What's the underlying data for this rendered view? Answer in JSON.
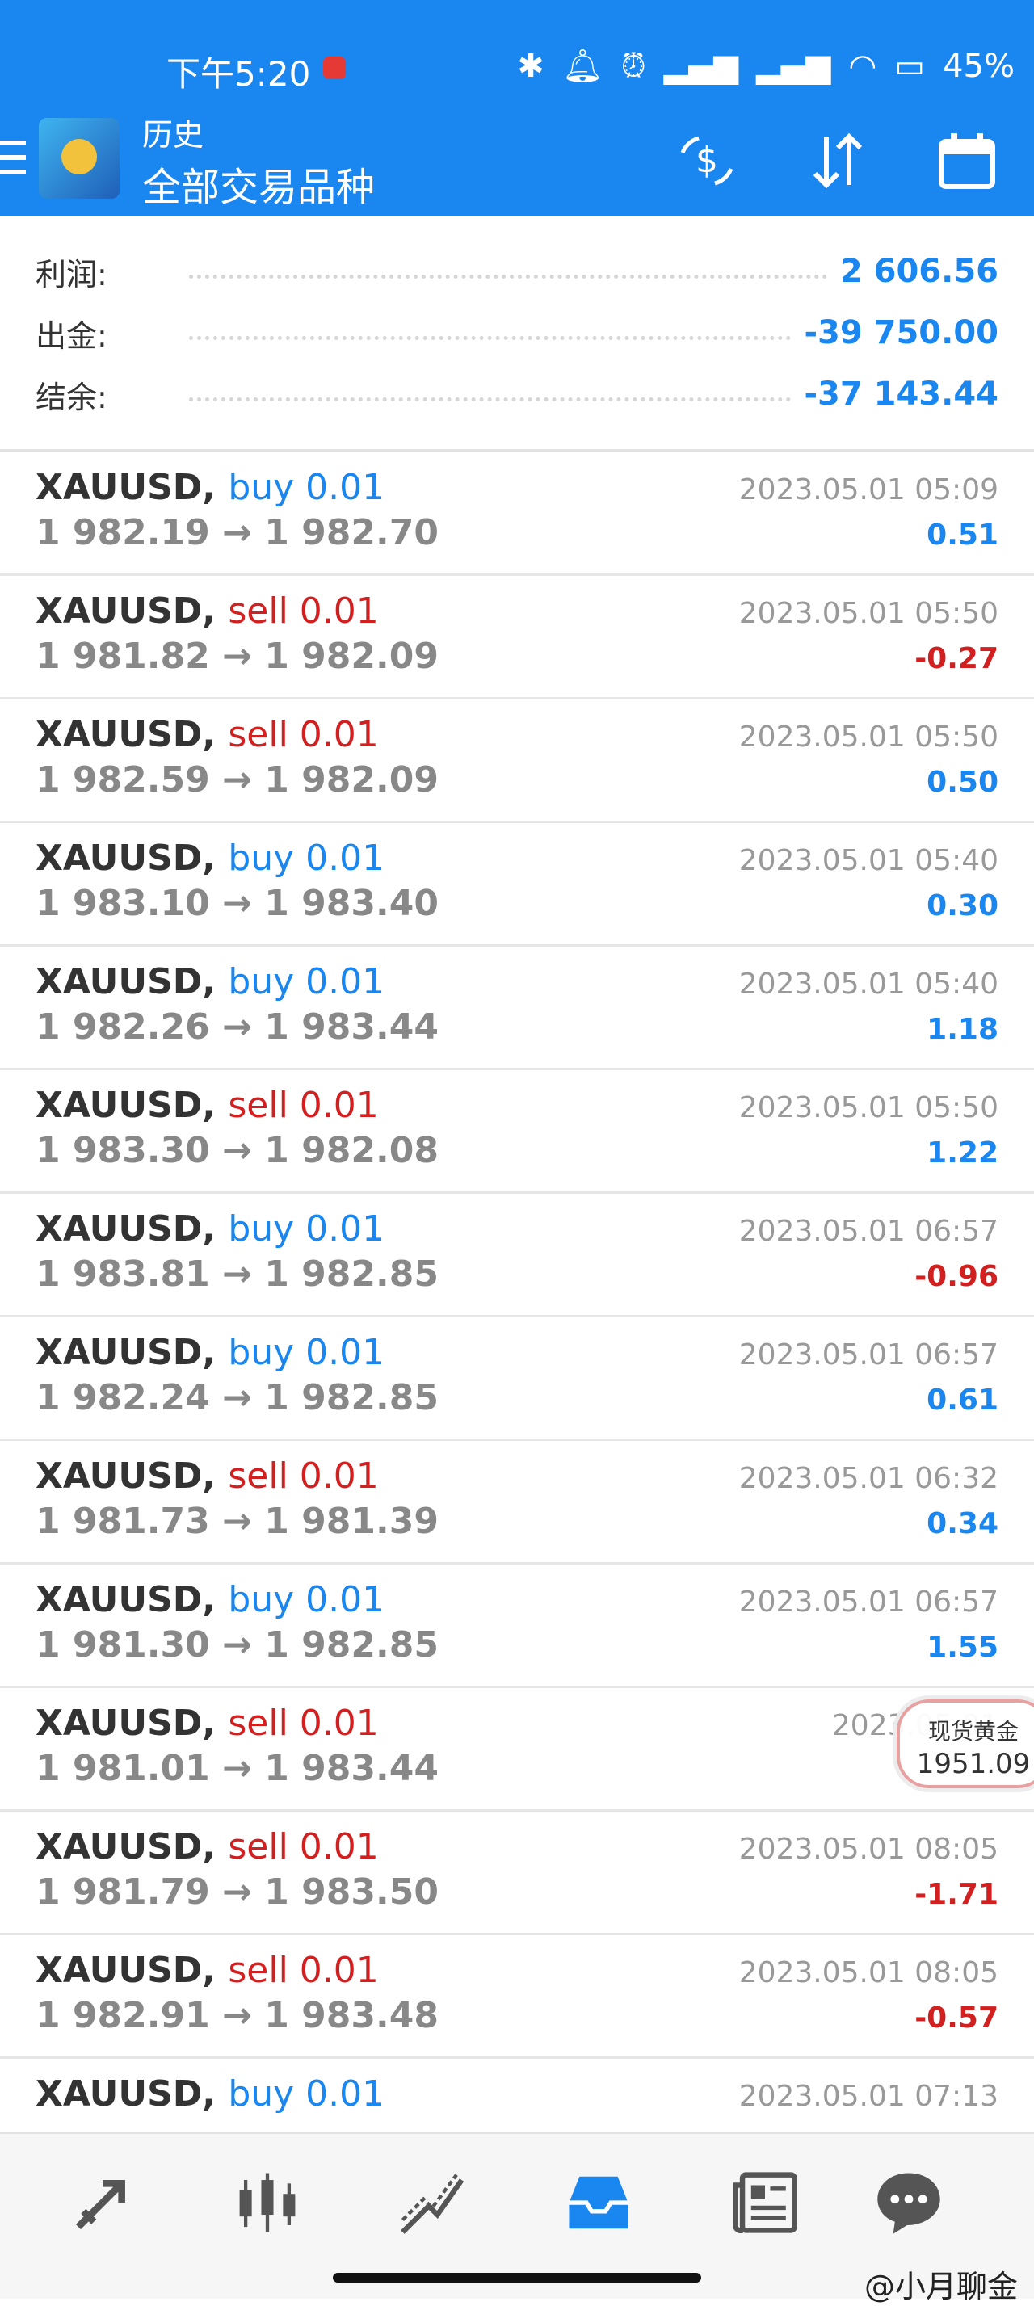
{
  "status": {
    "time": "下午5:20",
    "battery": "45%"
  },
  "header": {
    "subtitle": "历史",
    "title": "全部交易品种"
  },
  "summary": [
    {
      "label": "利润:",
      "value": "2 606.56"
    },
    {
      "label": "出金:",
      "value": "-39 750.00"
    },
    {
      "label": "结余:",
      "value": "-37 143.44"
    }
  ],
  "trades": [
    {
      "symbol": "XAUUSD,",
      "type": "buy 0.01",
      "side": "buy",
      "prices": "1 982.19 → 1 982.70",
      "time": "2023.05.01 05:09",
      "profit": "0.51"
    },
    {
      "symbol": "XAUUSD,",
      "type": "sell 0.01",
      "side": "sell",
      "prices": "1 981.82 → 1 982.09",
      "time": "2023.05.01 05:50",
      "profit": "-0.27"
    },
    {
      "symbol": "XAUUSD,",
      "type": "sell 0.01",
      "side": "sell",
      "prices": "1 982.59 → 1 982.09",
      "time": "2023.05.01 05:50",
      "profit": "0.50"
    },
    {
      "symbol": "XAUUSD,",
      "type": "buy 0.01",
      "side": "buy",
      "prices": "1 983.10 → 1 983.40",
      "time": "2023.05.01 05:40",
      "profit": "0.30"
    },
    {
      "symbol": "XAUUSD,",
      "type": "buy 0.01",
      "side": "buy",
      "prices": "1 982.26 → 1 983.44",
      "time": "2023.05.01 05:40",
      "profit": "1.18"
    },
    {
      "symbol": "XAUUSD,",
      "type": "sell 0.01",
      "side": "sell",
      "prices": "1 983.30 → 1 982.08",
      "time": "2023.05.01 05:50",
      "profit": "1.22"
    },
    {
      "symbol": "XAUUSD,",
      "type": "buy 0.01",
      "side": "buy",
      "prices": "1 983.81 → 1 982.85",
      "time": "2023.05.01 06:57",
      "profit": "-0.96"
    },
    {
      "symbol": "XAUUSD,",
      "type": "buy 0.01",
      "side": "buy",
      "prices": "1 982.24 → 1 982.85",
      "time": "2023.05.01 06:57",
      "profit": "0.61"
    },
    {
      "symbol": "XAUUSD,",
      "type": "sell 0.01",
      "side": "sell",
      "prices": "1 981.73 → 1 981.39",
      "time": "2023.05.01 06:32",
      "profit": "0.34"
    },
    {
      "symbol": "XAUUSD,",
      "type": "buy 0.01",
      "side": "buy",
      "prices": "1 981.30 → 1 982.85",
      "time": "2023.05.01 06:57",
      "profit": "1.55"
    },
    {
      "symbol": "XAUUSD,",
      "type": "sell 0.01",
      "side": "sell",
      "prices": "1 981.01 → 1 983.44",
      "time": "2023.05.01",
      "profit": ""
    },
    {
      "symbol": "XAUUSD,",
      "type": "sell 0.01",
      "side": "sell",
      "prices": "1 981.79 → 1 983.50",
      "time": "2023.05.01 08:05",
      "profit": "-1.71"
    },
    {
      "symbol": "XAUUSD,",
      "type": "sell 0.01",
      "side": "sell",
      "prices": "1 982.91 → 1 983.48",
      "time": "2023.05.01 08:05",
      "profit": "-0.57"
    },
    {
      "symbol": "XAUUSD,",
      "type": "buy 0.01",
      "side": "buy",
      "prices": "",
      "time": "2023.05.01 07:13",
      "profit": ""
    }
  ],
  "float_badge": {
    "label": "现货黄金",
    "value": "1951.09"
  },
  "watermark": "@小月聊金",
  "colors": {
    "brand": "#1a86f0",
    "buy": "#1a86f0",
    "sell": "#d21f1f",
    "negative": "#d21f1f"
  },
  "nav": [
    "trade-icon",
    "quotes-icon",
    "chart-icon",
    "history-icon",
    "news-icon",
    "messages-icon"
  ]
}
